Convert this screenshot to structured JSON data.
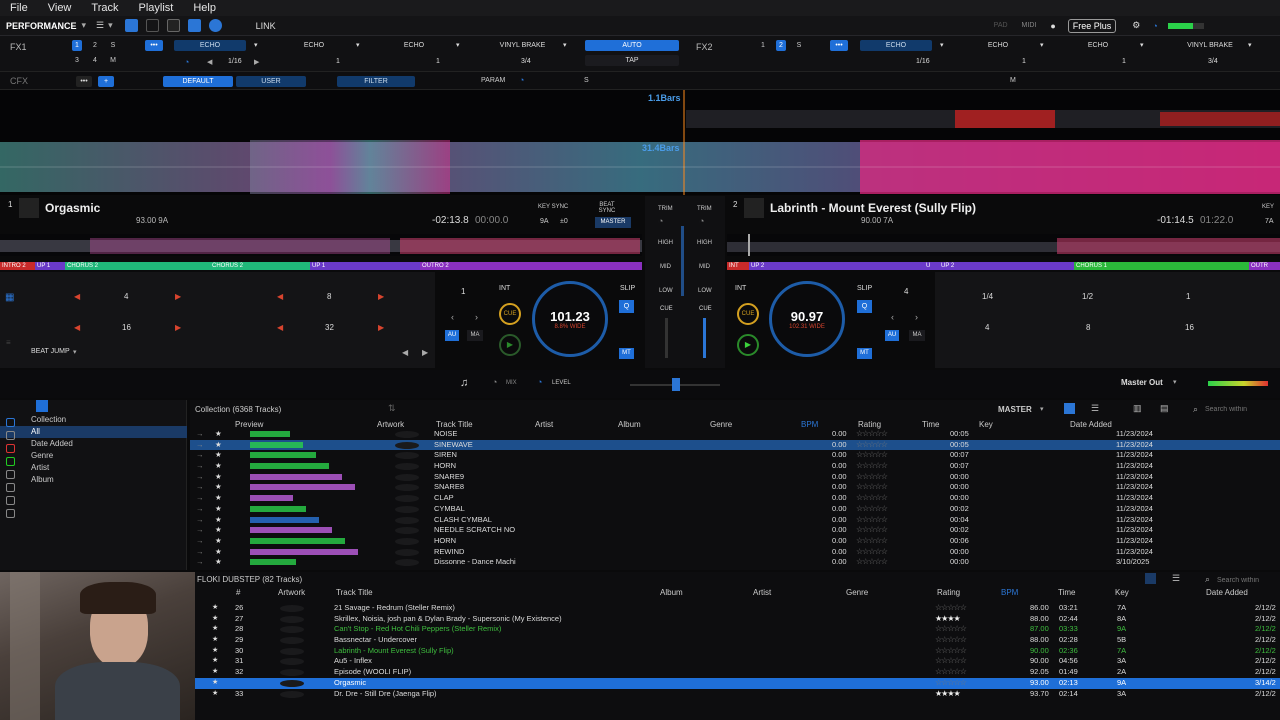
{
  "menu": [
    "File",
    "View",
    "Track",
    "Playlist",
    "Help"
  ],
  "toolbar": {
    "layout": "PERFORMANCE",
    "link": "LINK",
    "pad": "PAD",
    "midi": "MIDI",
    "freeplus": "Free Plus"
  },
  "fx1": {
    "label": "FX1",
    "units": [
      "ECHO",
      "ECHO",
      "ECHO"
    ],
    "vinyl": "VINYL BRAKE",
    "auto": "AUTO",
    "tap": "TAP",
    "beat": "1/16",
    "vinyl_beat": "3/4",
    "num": "1"
  },
  "fx2": {
    "label": "FX2",
    "units": [
      "ECHO",
      "ECHO",
      "ECHO"
    ],
    "vinyl": "VINYL BRAKE",
    "beat": "1/16",
    "vinyl_beat": "3/4",
    "num": "1"
  },
  "cfx": {
    "label": "CFX",
    "default": "DEFAULT",
    "user": "USER",
    "filter": "FILTER",
    "param": "PARAM",
    "s": "S",
    "m": "M"
  },
  "overview": {
    "bars_top": "1.1Bars",
    "bars_mid": "31.4Bars"
  },
  "deck1": {
    "num": "1",
    "title": "Orgasmic",
    "sub": "93.00  9A",
    "remain": "-02:13.8",
    "elapsed": "00:00.0",
    "key_sync": "KEY SYNC",
    "beat_sync": "BEAT SYNC",
    "key": "9A",
    "pm": "±0",
    "master": "MASTER",
    "cues": [
      "INTRO 2",
      "UP 1",
      "CHORUS 2",
      "CHORUS 2",
      "UP 1",
      "OUTRO 2"
    ],
    "loops": [
      "4",
      "8",
      "16",
      "32"
    ],
    "beatjump": "BEAT JUMP",
    "int": "INT",
    "cue": "CUE",
    "slip": "SLIP",
    "q": "Q",
    "au": "AU",
    "ma": "MA",
    "mt": "MT",
    "bpm": "101.23",
    "pct": "8.8% WIDE",
    "beat": "1"
  },
  "deck2": {
    "num": "2",
    "title": "Labrinth - Mount Everest (Sully Flip)",
    "sub": "90.00  7A",
    "remain": "-01:14.5",
    "elapsed": "01:22.0",
    "key": "KEY",
    "keynum": "7A",
    "cues": [
      "INT",
      "UP 2",
      "U",
      "UP 2",
      "CHORUS 1",
      "OUTR"
    ],
    "loops": [
      "1/4",
      "1/2",
      "1",
      "4",
      "8",
      "16"
    ],
    "int": "INT",
    "cue": "CUE",
    "slip": "SLIP",
    "q": "Q",
    "au": "AU",
    "ma": "MA",
    "mt": "MT",
    "bpm": "90.97",
    "pct": "102.31 WIDE",
    "beat": "4"
  },
  "mixer": {
    "trim": "TRIM",
    "high": "HIGH",
    "mid": "MID",
    "low": "LOW",
    "cue": "CUE",
    "mix": "MIX",
    "level": "LEVEL",
    "master_out": "Master Out"
  },
  "sidebar": {
    "items": [
      "Collection",
      "All",
      "Date Added",
      "Genre",
      "Artist",
      "Album"
    ]
  },
  "browser": {
    "title": "Collection (6368 Tracks)",
    "master": "MASTER",
    "search": "Search within",
    "cols": [
      "Preview",
      "Artwork",
      "Track Title",
      "Artist",
      "Album",
      "Genre",
      "BPM",
      "Rating",
      "Time",
      "Key",
      "Date Added"
    ],
    "rows": [
      {
        "title": "NOISE",
        "bpm": "0.00",
        "time": "00:05",
        "date": "11/23/2024"
      },
      {
        "title": "SINEWAVE",
        "bpm": "0.00",
        "time": "00:05",
        "date": "11/23/2024"
      },
      {
        "title": "SIREN",
        "bpm": "0.00",
        "time": "00:07",
        "date": "11/23/2024"
      },
      {
        "title": "HORN",
        "bpm": "0.00",
        "time": "00:07",
        "date": "11/23/2024"
      },
      {
        "title": "SNARE9",
        "bpm": "0.00",
        "time": "00:00",
        "date": "11/23/2024"
      },
      {
        "title": "SNARE8",
        "bpm": "0.00",
        "time": "00:00",
        "date": "11/23/2024"
      },
      {
        "title": "CLAP",
        "bpm": "0.00",
        "time": "00:00",
        "date": "11/23/2024"
      },
      {
        "title": "CYMBAL",
        "bpm": "0.00",
        "time": "00:02",
        "date": "11/23/2024"
      },
      {
        "title": "CLASH CYMBAL",
        "bpm": "0.00",
        "time": "00:04",
        "date": "11/23/2024"
      },
      {
        "title": "NEEDLE SCRATCH NO",
        "bpm": "0.00",
        "time": "00:02",
        "date": "11/23/2024"
      },
      {
        "title": "HORN",
        "bpm": "0.00",
        "time": "00:06",
        "date": "11/23/2024"
      },
      {
        "title": "REWIND",
        "bpm": "0.00",
        "time": "00:00",
        "date": "11/23/2024"
      },
      {
        "title": "Dissonne - Dance Machi",
        "bpm": "0.00",
        "time": "00:00",
        "date": "3/10/2025"
      }
    ]
  },
  "playlist": {
    "title": "FLOKI DUBSTEP (82 Tracks)",
    "cols": [
      "#",
      "Artwork",
      "Track Title",
      "Album",
      "Artist",
      "Genre",
      "Rating",
      "BPM",
      "Time",
      "Key",
      "Date Added"
    ],
    "rows": [
      {
        "n": "26",
        "title": "21 Savage - Redrum (Steller Remix)",
        "bpm": "86.00",
        "time": "03:21",
        "key": "7A",
        "date": "2/12/2",
        "color": "#dcdcdc",
        "filled": false
      },
      {
        "n": "27",
        "title": "Skrillex, Noisia, josh pan & Dylan Brady - Supersonic (My Existence)",
        "bpm": "88.00",
        "time": "02:44",
        "key": "8A",
        "date": "2/12/2",
        "color": "#dcdcdc",
        "filled": true
      },
      {
        "n": "28",
        "title": "Can't Stop - Red Hot Chili Peppers (Steller Remix)",
        "bpm": "87.00",
        "time": "03:33",
        "key": "9A",
        "date": "2/12/2",
        "color": "#3fbf3f",
        "filled": false
      },
      {
        "n": "29",
        "title": "Bassnectar - Undercover",
        "bpm": "88.00",
        "time": "02:28",
        "key": "5B",
        "date": "2/12/2",
        "color": "#dcdcdc",
        "filled": false
      },
      {
        "n": "30",
        "title": "Labrinth - Mount Everest (Sully Flip)",
        "bpm": "90.00",
        "time": "02:36",
        "key": "7A",
        "date": "2/12/2",
        "color": "#3fbf3f",
        "filled": false
      },
      {
        "n": "31",
        "title": "Au5 - Inflex",
        "bpm": "90.00",
        "time": "04:56",
        "key": "3A",
        "date": "2/12/2",
        "color": "#dcdcdc",
        "filled": false
      },
      {
        "n": "32",
        "title": "Episode (WOOLI FLIP)",
        "bpm": "92.05",
        "time": "01:49",
        "key": "2A",
        "date": "2/12/2",
        "color": "#dcdcdc",
        "filled": false
      },
      {
        "n": "",
        "title": "Orgasmic",
        "bpm": "93.00",
        "time": "02:13",
        "key": "9A",
        "date": "3/14/2",
        "color": "#ffffff",
        "filled": false,
        "sel": true
      },
      {
        "n": "33",
        "title": "Dr. Dre - Still Dre (Jaenga Flip)",
        "bpm": "93.70",
        "time": "02:14",
        "key": "3A",
        "date": "2/12/2",
        "color": "#dcdcdc",
        "filled": true
      }
    ]
  }
}
